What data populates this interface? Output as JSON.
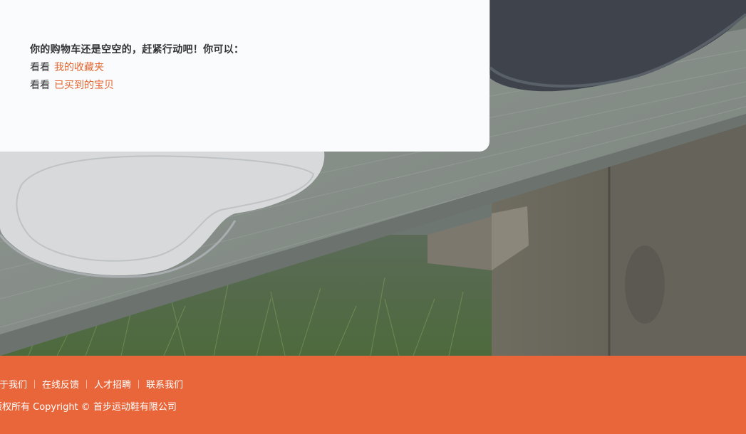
{
  "cart": {
    "empty_message": "你的购物车还是空空的，赶紧行动吧！你可以：",
    "suggestions": [
      {
        "prefix": "看看",
        "link": "我的收藏夹"
      },
      {
        "prefix": "看看",
        "link": "已买到的宝贝"
      }
    ],
    "link_color": "#e6652f"
  },
  "footer": {
    "links": [
      {
        "label": "关于我们"
      },
      {
        "label": "在线反馈"
      },
      {
        "label": "人才招聘"
      },
      {
        "label": "联系我们"
      }
    ],
    "copyright": "版权所有 Copyright © 首步运动鞋有限公司",
    "background_color": "#e8663a"
  },
  "background": {
    "description_icon": "shoes-on-wooden-bench-photo"
  }
}
